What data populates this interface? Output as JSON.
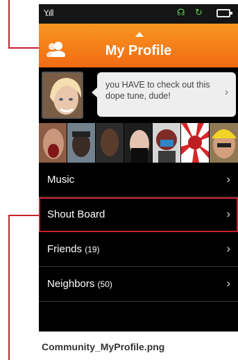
{
  "status_bar": {
    "signal_text": "Y.ıll",
    "network_icon": "green-voice-icon",
    "sync_icon": "green-sync-icon",
    "battery_icon": "battery-icon"
  },
  "header": {
    "title": "My Profile",
    "accent_color": "#f26b14"
  },
  "profile": {
    "status_message": "you HAVE to check out this dope tune, dude!",
    "chevron": "›"
  },
  "friends_strip": {
    "count_shown": 7
  },
  "menu": {
    "items": [
      {
        "label": "Music",
        "count": "",
        "chevron": "›"
      },
      {
        "label": "Shout Board",
        "count": "",
        "chevron": "›"
      },
      {
        "label": "Friends",
        "count": "(19)",
        "chevron": "›"
      },
      {
        "label": "Neighbors",
        "count": "(50)",
        "chevron": "›"
      }
    ]
  },
  "caption": "Community_MyProfile.png",
  "annotation_color": "#c8202f"
}
